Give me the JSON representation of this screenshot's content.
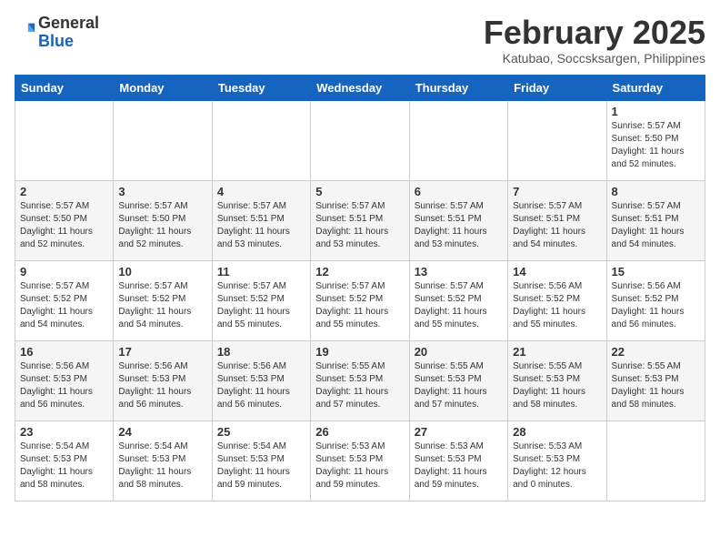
{
  "header": {
    "logo": {
      "line1": "General",
      "line2": "Blue"
    },
    "title": "February 2025",
    "location": "Katubao, Soccsksargen, Philippines"
  },
  "calendar": {
    "days_of_week": [
      "Sunday",
      "Monday",
      "Tuesday",
      "Wednesday",
      "Thursday",
      "Friday",
      "Saturday"
    ],
    "weeks": [
      [
        {
          "day": "",
          "info": ""
        },
        {
          "day": "",
          "info": ""
        },
        {
          "day": "",
          "info": ""
        },
        {
          "day": "",
          "info": ""
        },
        {
          "day": "",
          "info": ""
        },
        {
          "day": "",
          "info": ""
        },
        {
          "day": "1",
          "info": "Sunrise: 5:57 AM\nSunset: 5:50 PM\nDaylight: 11 hours\nand 52 minutes."
        }
      ],
      [
        {
          "day": "2",
          "info": "Sunrise: 5:57 AM\nSunset: 5:50 PM\nDaylight: 11 hours\nand 52 minutes."
        },
        {
          "day": "3",
          "info": "Sunrise: 5:57 AM\nSunset: 5:50 PM\nDaylight: 11 hours\nand 52 minutes."
        },
        {
          "day": "4",
          "info": "Sunrise: 5:57 AM\nSunset: 5:51 PM\nDaylight: 11 hours\nand 53 minutes."
        },
        {
          "day": "5",
          "info": "Sunrise: 5:57 AM\nSunset: 5:51 PM\nDaylight: 11 hours\nand 53 minutes."
        },
        {
          "day": "6",
          "info": "Sunrise: 5:57 AM\nSunset: 5:51 PM\nDaylight: 11 hours\nand 53 minutes."
        },
        {
          "day": "7",
          "info": "Sunrise: 5:57 AM\nSunset: 5:51 PM\nDaylight: 11 hours\nand 54 minutes."
        },
        {
          "day": "8",
          "info": "Sunrise: 5:57 AM\nSunset: 5:51 PM\nDaylight: 11 hours\nand 54 minutes."
        }
      ],
      [
        {
          "day": "9",
          "info": "Sunrise: 5:57 AM\nSunset: 5:52 PM\nDaylight: 11 hours\nand 54 minutes."
        },
        {
          "day": "10",
          "info": "Sunrise: 5:57 AM\nSunset: 5:52 PM\nDaylight: 11 hours\nand 54 minutes."
        },
        {
          "day": "11",
          "info": "Sunrise: 5:57 AM\nSunset: 5:52 PM\nDaylight: 11 hours\nand 55 minutes."
        },
        {
          "day": "12",
          "info": "Sunrise: 5:57 AM\nSunset: 5:52 PM\nDaylight: 11 hours\nand 55 minutes."
        },
        {
          "day": "13",
          "info": "Sunrise: 5:57 AM\nSunset: 5:52 PM\nDaylight: 11 hours\nand 55 minutes."
        },
        {
          "day": "14",
          "info": "Sunrise: 5:56 AM\nSunset: 5:52 PM\nDaylight: 11 hours\nand 55 minutes."
        },
        {
          "day": "15",
          "info": "Sunrise: 5:56 AM\nSunset: 5:52 PM\nDaylight: 11 hours\nand 56 minutes."
        }
      ],
      [
        {
          "day": "16",
          "info": "Sunrise: 5:56 AM\nSunset: 5:53 PM\nDaylight: 11 hours\nand 56 minutes."
        },
        {
          "day": "17",
          "info": "Sunrise: 5:56 AM\nSunset: 5:53 PM\nDaylight: 11 hours\nand 56 minutes."
        },
        {
          "day": "18",
          "info": "Sunrise: 5:56 AM\nSunset: 5:53 PM\nDaylight: 11 hours\nand 56 minutes."
        },
        {
          "day": "19",
          "info": "Sunrise: 5:55 AM\nSunset: 5:53 PM\nDaylight: 11 hours\nand 57 minutes."
        },
        {
          "day": "20",
          "info": "Sunrise: 5:55 AM\nSunset: 5:53 PM\nDaylight: 11 hours\nand 57 minutes."
        },
        {
          "day": "21",
          "info": "Sunrise: 5:55 AM\nSunset: 5:53 PM\nDaylight: 11 hours\nand 58 minutes."
        },
        {
          "day": "22",
          "info": "Sunrise: 5:55 AM\nSunset: 5:53 PM\nDaylight: 11 hours\nand 58 minutes."
        }
      ],
      [
        {
          "day": "23",
          "info": "Sunrise: 5:54 AM\nSunset: 5:53 PM\nDaylight: 11 hours\nand 58 minutes."
        },
        {
          "day": "24",
          "info": "Sunrise: 5:54 AM\nSunset: 5:53 PM\nDaylight: 11 hours\nand 58 minutes."
        },
        {
          "day": "25",
          "info": "Sunrise: 5:54 AM\nSunset: 5:53 PM\nDaylight: 11 hours\nand 59 minutes."
        },
        {
          "day": "26",
          "info": "Sunrise: 5:53 AM\nSunset: 5:53 PM\nDaylight: 11 hours\nand 59 minutes."
        },
        {
          "day": "27",
          "info": "Sunrise: 5:53 AM\nSunset: 5:53 PM\nDaylight: 11 hours\nand 59 minutes."
        },
        {
          "day": "28",
          "info": "Sunrise: 5:53 AM\nSunset: 5:53 PM\nDaylight: 12 hours\nand 0 minutes."
        },
        {
          "day": "",
          "info": ""
        }
      ]
    ]
  }
}
